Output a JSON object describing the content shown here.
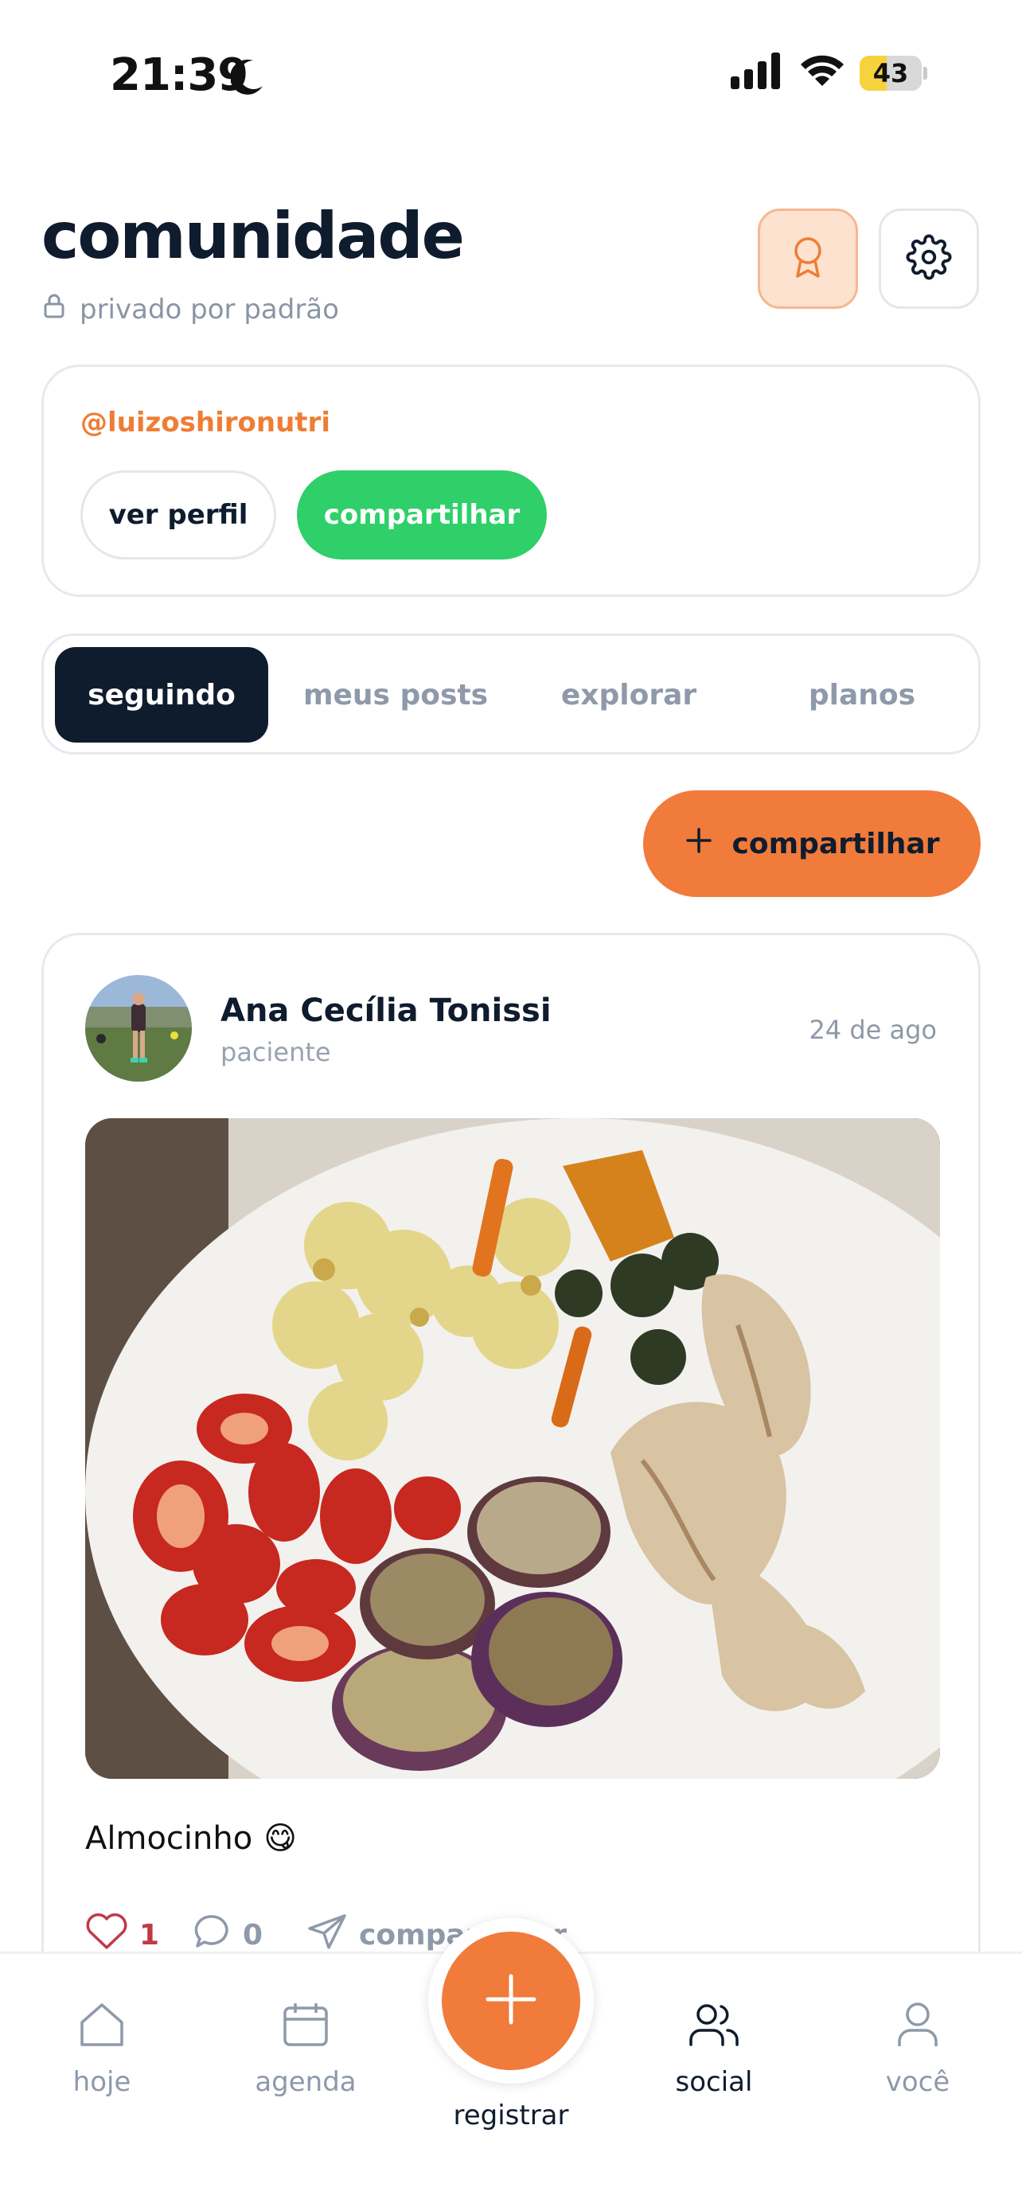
{
  "status_bar": {
    "time": "21:39",
    "battery": "43",
    "battery_level": 0.43
  },
  "header": {
    "title": "comunidade",
    "privacy_text": "privado por padrão",
    "award_icon": "award-icon",
    "settings_icon": "gear-icon"
  },
  "profile_card": {
    "handle": "@luizoshironutri",
    "view_profile_label": "ver perfil",
    "share_label": "compartilhar"
  },
  "tabs": [
    {
      "label": "seguindo",
      "active": true
    },
    {
      "label": "meus posts",
      "active": false
    },
    {
      "label": "explorar",
      "active": false
    },
    {
      "label": "planos",
      "active": false
    }
  ],
  "share_button": {
    "label": "compartilhar"
  },
  "post": {
    "author": "Ana Cecília Tonissi",
    "role": "paciente",
    "date": "24 de ago",
    "caption": "Almocinho",
    "caption_emoji": "😋",
    "likes": "1",
    "comments": "0",
    "share_label": "compartilhar"
  },
  "bottom_nav": {
    "items": [
      {
        "label": "hoje",
        "icon": "home-icon",
        "active": false
      },
      {
        "label": "agenda",
        "icon": "calendar-icon",
        "active": false
      },
      {
        "label": "social",
        "icon": "users-icon",
        "active": true
      },
      {
        "label": "você",
        "icon": "user-icon",
        "active": false
      }
    ],
    "center_label": "registrar",
    "center_icon": "plus-icon"
  },
  "colors": {
    "accent_orange": "#f07b3a",
    "green": "#2fcf6a",
    "navy": "#0f1c2e",
    "muted": "#8e99aa",
    "like_red": "#c0394a"
  }
}
